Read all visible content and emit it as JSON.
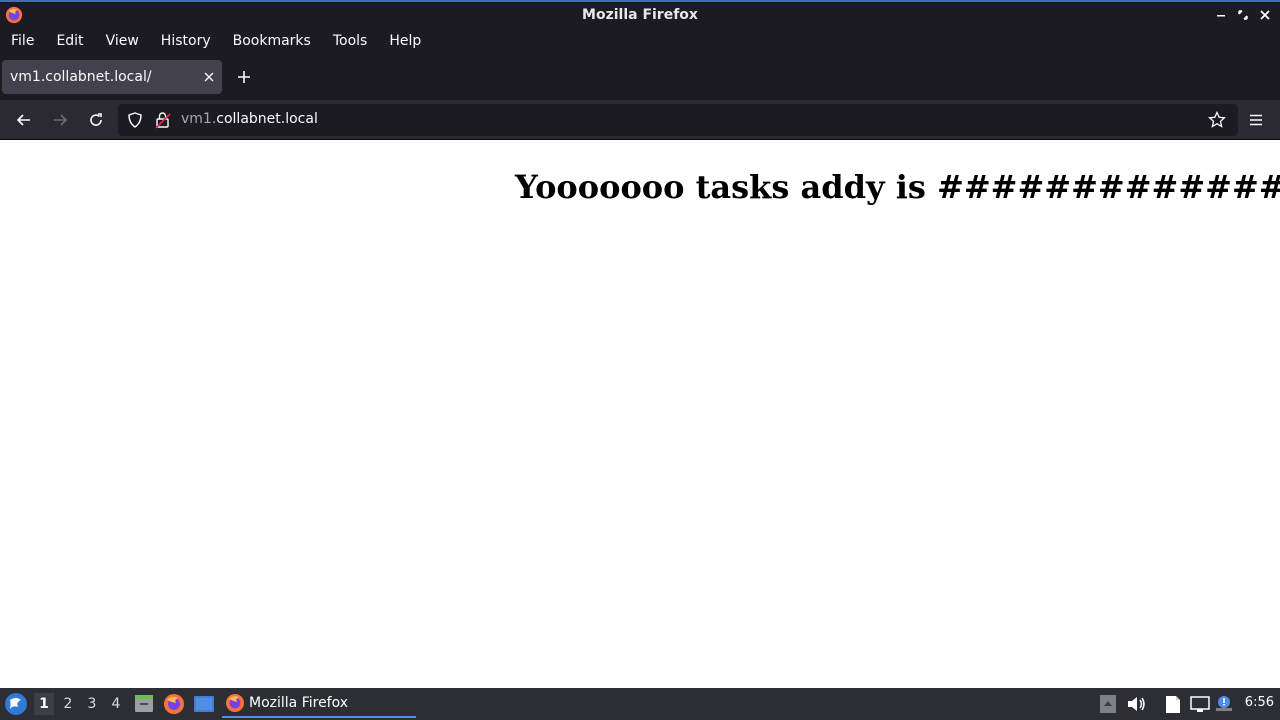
{
  "window": {
    "title": "Mozilla Firefox"
  },
  "menubar": {
    "items": [
      {
        "label": "File"
      },
      {
        "label": "Edit"
      },
      {
        "label": "View"
      },
      {
        "label": "History"
      },
      {
        "label": "Bookmarks"
      },
      {
        "label": "Tools"
      },
      {
        "label": "Help"
      }
    ]
  },
  "tabs": [
    {
      "title": "vm1.collabnet.local/",
      "active": true
    }
  ],
  "navbar": {
    "url_subdomain": "vm1.",
    "url_domain": "collabnet.local"
  },
  "page": {
    "heading": "Yooooooo tasks addy is ##############"
  },
  "taskbar": {
    "workspaces": [
      "1",
      "2",
      "3",
      "4"
    ],
    "active_workspace": "1",
    "task_label": "Mozilla Firefox",
    "clock": "6:56"
  },
  "icons": {
    "app": "firefox-icon",
    "start": "start-menu-icon",
    "back": "back-arrow-icon",
    "forward": "forward-arrow-icon",
    "reload": "reload-icon",
    "shield": "tracking-shield-icon",
    "lock": "insecure-lock-icon",
    "bookmark": "bookmark-star-icon",
    "menu": "hamburger-menu-icon"
  },
  "colors": {
    "titlebar": "#1c1b22",
    "navbar": "#2b2a33",
    "tab_active": "#42414d",
    "taskbar": "#2c2e34",
    "accent": "#4f8ee3",
    "insecure": "#e22850"
  }
}
